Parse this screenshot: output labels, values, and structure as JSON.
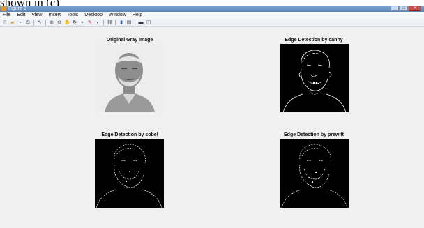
{
  "page_caption": "shown in (c)",
  "window": {
    "title": "Figure 2",
    "controls": {
      "minimize": "–",
      "maximize": "□",
      "close": "✕"
    }
  },
  "menu": [
    "File",
    "Edit",
    "View",
    "Insert",
    "Tools",
    "Desktop",
    "Window",
    "Help"
  ],
  "toolbar_icons": [
    "new-figure-icon",
    "open-icon",
    "save-icon",
    "print-icon",
    "pointer-icon",
    "zoom-in-icon",
    "zoom-out-icon",
    "pan-icon",
    "rotate-icon",
    "data-cursor-icon",
    "brush-icon",
    "link-icon",
    "colorbar-icon",
    "legend-icon",
    "hide-plot-tools-icon",
    "show-plot-tools-icon"
  ],
  "panels": [
    {
      "title": "Original Gray Image",
      "image": "original-gray-portrait"
    },
    {
      "title": "Edge Detection by canny",
      "image": "canny-edge-map"
    },
    {
      "title": "Edge Detection by sobel",
      "image": "sobel-edge-map"
    },
    {
      "title": "Edge Detection by prewitt",
      "image": "prewitt-edge-map"
    }
  ],
  "colors": {
    "figure_bg": "#f0f0f0",
    "titlebar": "#5b86bd",
    "edge_bg": "#000000",
    "edge_stroke": "#ffffff"
  }
}
